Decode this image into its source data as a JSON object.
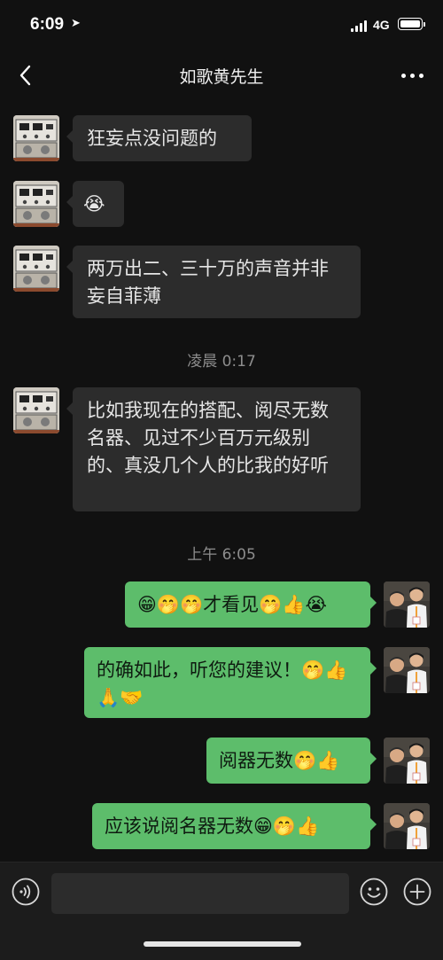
{
  "status_bar": {
    "time": "6:09",
    "network": "4G"
  },
  "header": {
    "title": "如歌黄先生"
  },
  "messages": [
    {
      "text": "狂妄点没问题的"
    },
    {
      "text": "😭"
    },
    {
      "text": "两万出二、三十万的声音并非妄自菲薄"
    },
    {
      "text": "比如我现在的搭配、阅尽无数名器、见过不少百万元级别的、真没几个人的比我的好听"
    },
    {
      "text": "😁🤭🤭才看见🤭👍😭"
    },
    {
      "text": "的确如此，听您的建议！🤭👍🙏🤝"
    },
    {
      "text": "阅器无数🤭👍"
    },
    {
      "text": "应该说阅名器无数😁🤭👍"
    }
  ],
  "timestamps": [
    "凌晨 0:17",
    "上午 6:05"
  ],
  "icons": {
    "back": "back-chevron-icon",
    "more": "more-dots-icon",
    "voice": "voice-icon",
    "emoji": "emoji-icon",
    "plus": "plus-icon"
  },
  "colors": {
    "background": "#111111",
    "incoming_bubble": "#2c2c2c",
    "outgoing_bubble": "#5dbd6b"
  }
}
